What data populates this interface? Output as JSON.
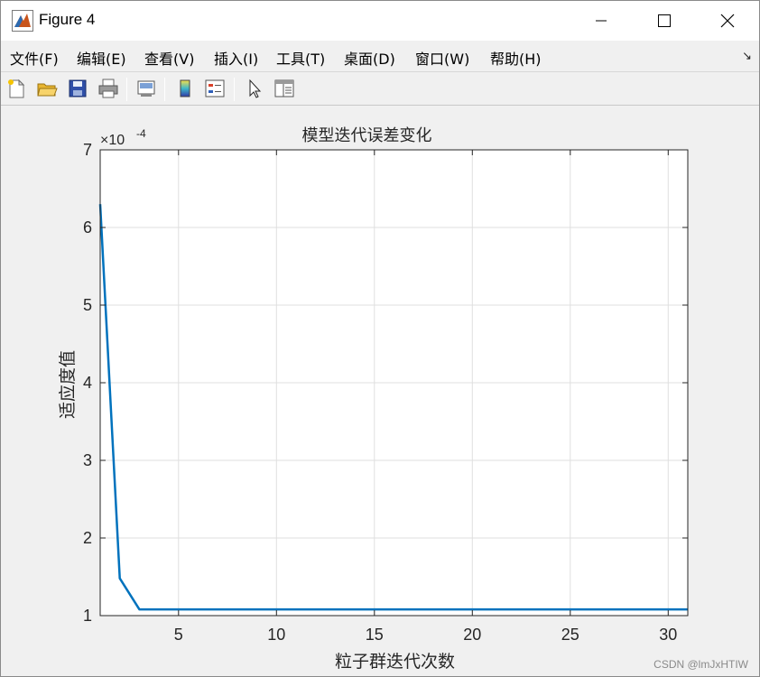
{
  "window": {
    "title": "Figure 4",
    "icon": "matlab-figure-icon",
    "controls": [
      "minimize-icon",
      "maximize-icon",
      "close-icon"
    ]
  },
  "menu": {
    "items": [
      "文件(F)",
      "编辑(E)",
      "查看(V)",
      "插入(I)",
      "工具(T)",
      "桌面(D)",
      "窗口(W)",
      "帮助(H)"
    ],
    "dock_icon": "↘"
  },
  "toolbar": {
    "buttons": [
      "new-figure-icon",
      "open-file-icon",
      "save-icon",
      "print-icon",
      "link-plot-icon",
      "colorbar-icon",
      "legend-icon",
      "edit-plot-arrow-icon",
      "property-inspector-icon"
    ]
  },
  "chart_data": {
    "type": "line",
    "title": "模型迭代误差变化",
    "xlabel": "粒子群迭代次数",
    "ylabel": "适应度值",
    "exponent_label": "×10",
    "exponent_power": "-4",
    "xlim": [
      1,
      31
    ],
    "ylim": [
      1,
      7
    ],
    "xticks": [
      5,
      10,
      15,
      20,
      25,
      30
    ],
    "yticks": [
      1,
      2,
      3,
      4,
      5,
      6,
      7
    ],
    "grid": true,
    "series": [
      {
        "color": "#0072BD",
        "x": [
          1,
          2,
          3,
          4,
          5,
          6,
          7,
          8,
          9,
          10,
          11,
          12,
          13,
          14,
          15,
          16,
          17,
          18,
          19,
          20,
          21,
          22,
          23,
          24,
          25,
          26,
          27,
          28,
          29,
          30,
          31
        ],
        "y": [
          6.3,
          1.48,
          1.08,
          1.08,
          1.08,
          1.08,
          1.08,
          1.08,
          1.08,
          1.08,
          1.08,
          1.08,
          1.08,
          1.08,
          1.08,
          1.08,
          1.08,
          1.08,
          1.08,
          1.08,
          1.08,
          1.08,
          1.08,
          1.08,
          1.08,
          1.08,
          1.08,
          1.08,
          1.08,
          1.08,
          1.08
        ]
      }
    ]
  },
  "watermark": "CSDN @lmJxHTIW"
}
